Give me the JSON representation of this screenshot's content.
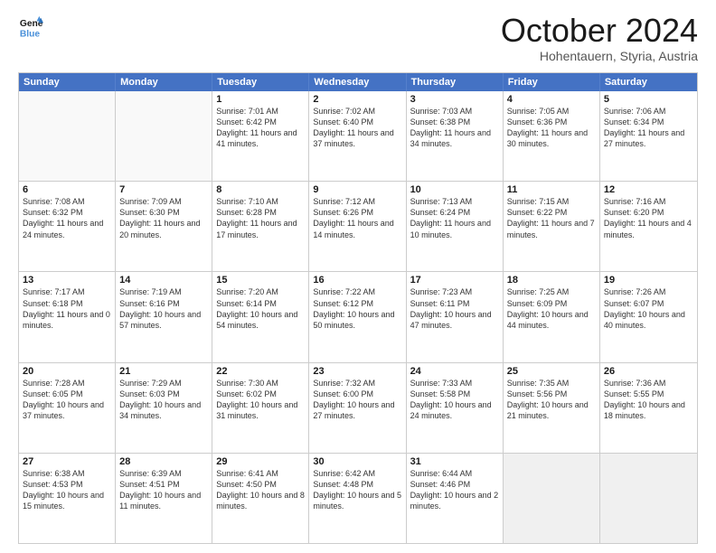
{
  "header": {
    "logo_line1": "General",
    "logo_line2": "Blue",
    "month": "October 2024",
    "location": "Hohentauern, Styria, Austria"
  },
  "weekdays": [
    "Sunday",
    "Monday",
    "Tuesday",
    "Wednesday",
    "Thursday",
    "Friday",
    "Saturday"
  ],
  "rows": [
    [
      {
        "day": "",
        "text": "",
        "empty": true
      },
      {
        "day": "",
        "text": "",
        "empty": true
      },
      {
        "day": "1",
        "text": "Sunrise: 7:01 AM\nSunset: 6:42 PM\nDaylight: 11 hours and 41 minutes."
      },
      {
        "day": "2",
        "text": "Sunrise: 7:02 AM\nSunset: 6:40 PM\nDaylight: 11 hours and 37 minutes."
      },
      {
        "day": "3",
        "text": "Sunrise: 7:03 AM\nSunset: 6:38 PM\nDaylight: 11 hours and 34 minutes."
      },
      {
        "day": "4",
        "text": "Sunrise: 7:05 AM\nSunset: 6:36 PM\nDaylight: 11 hours and 30 minutes."
      },
      {
        "day": "5",
        "text": "Sunrise: 7:06 AM\nSunset: 6:34 PM\nDaylight: 11 hours and 27 minutes."
      }
    ],
    [
      {
        "day": "6",
        "text": "Sunrise: 7:08 AM\nSunset: 6:32 PM\nDaylight: 11 hours and 24 minutes."
      },
      {
        "day": "7",
        "text": "Sunrise: 7:09 AM\nSunset: 6:30 PM\nDaylight: 11 hours and 20 minutes."
      },
      {
        "day": "8",
        "text": "Sunrise: 7:10 AM\nSunset: 6:28 PM\nDaylight: 11 hours and 17 minutes."
      },
      {
        "day": "9",
        "text": "Sunrise: 7:12 AM\nSunset: 6:26 PM\nDaylight: 11 hours and 14 minutes."
      },
      {
        "day": "10",
        "text": "Sunrise: 7:13 AM\nSunset: 6:24 PM\nDaylight: 11 hours and 10 minutes."
      },
      {
        "day": "11",
        "text": "Sunrise: 7:15 AM\nSunset: 6:22 PM\nDaylight: 11 hours and 7 minutes."
      },
      {
        "day": "12",
        "text": "Sunrise: 7:16 AM\nSunset: 6:20 PM\nDaylight: 11 hours and 4 minutes."
      }
    ],
    [
      {
        "day": "13",
        "text": "Sunrise: 7:17 AM\nSunset: 6:18 PM\nDaylight: 11 hours and 0 minutes."
      },
      {
        "day": "14",
        "text": "Sunrise: 7:19 AM\nSunset: 6:16 PM\nDaylight: 10 hours and 57 minutes."
      },
      {
        "day": "15",
        "text": "Sunrise: 7:20 AM\nSunset: 6:14 PM\nDaylight: 10 hours and 54 minutes."
      },
      {
        "day": "16",
        "text": "Sunrise: 7:22 AM\nSunset: 6:12 PM\nDaylight: 10 hours and 50 minutes."
      },
      {
        "day": "17",
        "text": "Sunrise: 7:23 AM\nSunset: 6:11 PM\nDaylight: 10 hours and 47 minutes."
      },
      {
        "day": "18",
        "text": "Sunrise: 7:25 AM\nSunset: 6:09 PM\nDaylight: 10 hours and 44 minutes."
      },
      {
        "day": "19",
        "text": "Sunrise: 7:26 AM\nSunset: 6:07 PM\nDaylight: 10 hours and 40 minutes."
      }
    ],
    [
      {
        "day": "20",
        "text": "Sunrise: 7:28 AM\nSunset: 6:05 PM\nDaylight: 10 hours and 37 minutes."
      },
      {
        "day": "21",
        "text": "Sunrise: 7:29 AM\nSunset: 6:03 PM\nDaylight: 10 hours and 34 minutes."
      },
      {
        "day": "22",
        "text": "Sunrise: 7:30 AM\nSunset: 6:02 PM\nDaylight: 10 hours and 31 minutes."
      },
      {
        "day": "23",
        "text": "Sunrise: 7:32 AM\nSunset: 6:00 PM\nDaylight: 10 hours and 27 minutes."
      },
      {
        "day": "24",
        "text": "Sunrise: 7:33 AM\nSunset: 5:58 PM\nDaylight: 10 hours and 24 minutes."
      },
      {
        "day": "25",
        "text": "Sunrise: 7:35 AM\nSunset: 5:56 PM\nDaylight: 10 hours and 21 minutes."
      },
      {
        "day": "26",
        "text": "Sunrise: 7:36 AM\nSunset: 5:55 PM\nDaylight: 10 hours and 18 minutes."
      }
    ],
    [
      {
        "day": "27",
        "text": "Sunrise: 6:38 AM\nSunset: 4:53 PM\nDaylight: 10 hours and 15 minutes."
      },
      {
        "day": "28",
        "text": "Sunrise: 6:39 AM\nSunset: 4:51 PM\nDaylight: 10 hours and 11 minutes."
      },
      {
        "day": "29",
        "text": "Sunrise: 6:41 AM\nSunset: 4:50 PM\nDaylight: 10 hours and 8 minutes."
      },
      {
        "day": "30",
        "text": "Sunrise: 6:42 AM\nSunset: 4:48 PM\nDaylight: 10 hours and 5 minutes."
      },
      {
        "day": "31",
        "text": "Sunrise: 6:44 AM\nSunset: 4:46 PM\nDaylight: 10 hours and 2 minutes."
      },
      {
        "day": "",
        "text": "",
        "empty": true,
        "shaded": true
      },
      {
        "day": "",
        "text": "",
        "empty": true,
        "shaded": true
      }
    ]
  ]
}
